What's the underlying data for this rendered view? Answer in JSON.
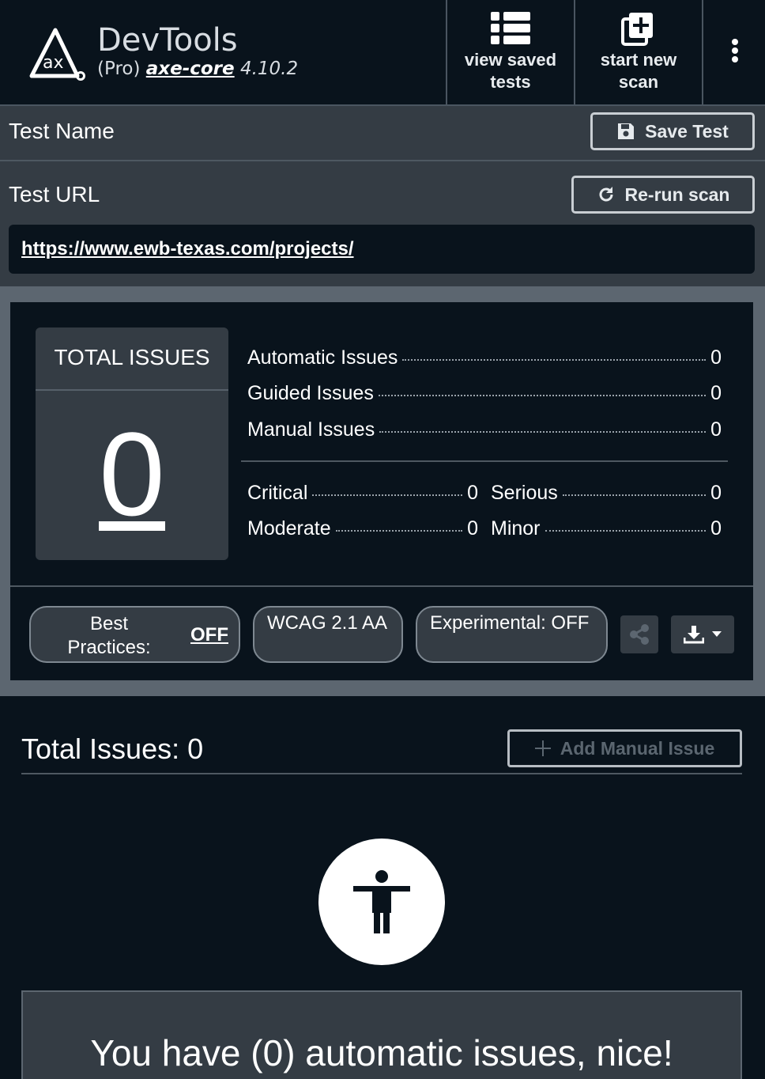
{
  "header": {
    "app_title": "DevTools",
    "edition": "(Pro)",
    "engine_name": "axe-core",
    "engine_version": "4.10.2",
    "view_saved_label": "view saved tests",
    "start_new_label": "start new scan"
  },
  "test": {
    "name_label": "Test Name",
    "save_label": "Save Test",
    "url_label": "Test URL",
    "rerun_label": "Re-run scan",
    "url": "https://www.ewb-texas.com/projects/"
  },
  "summary": {
    "total_label": "TOTAL ISSUES",
    "total_value": "0",
    "counts": [
      {
        "label": "Automatic Issues",
        "value": "0"
      },
      {
        "label": "Guided Issues",
        "value": "0"
      },
      {
        "label": "Manual Issues",
        "value": "0"
      }
    ],
    "severity": [
      {
        "label": "Critical",
        "value": "0"
      },
      {
        "label": "Serious",
        "value": "0"
      },
      {
        "label": "Moderate",
        "value": "0"
      },
      {
        "label": "Minor",
        "value": "0"
      }
    ],
    "best_practices_label": "Best Practices:",
    "best_practices_value": "OFF",
    "wcag_label": "WCAG 2.1 AA",
    "experimental_label": "Experimental: OFF"
  },
  "results": {
    "title": "Total Issues: 0",
    "add_manual_label": "Add Manual Issue",
    "message": "You have (0) automatic issues, nice!"
  },
  "icons": {
    "logo": "axe-logo",
    "saved": "list-icon",
    "new_scan": "add-scan-icon",
    "more": "kebab-icon",
    "save": "floppy-disk-icon",
    "rerun": "refresh-icon",
    "share": "share-icon",
    "download": "download-icon",
    "accessibility": "accessibility-person-icon"
  },
  "colors": {
    "background": "#09131c",
    "panel": "#343c44",
    "panel_border": "#5c6670"
  }
}
